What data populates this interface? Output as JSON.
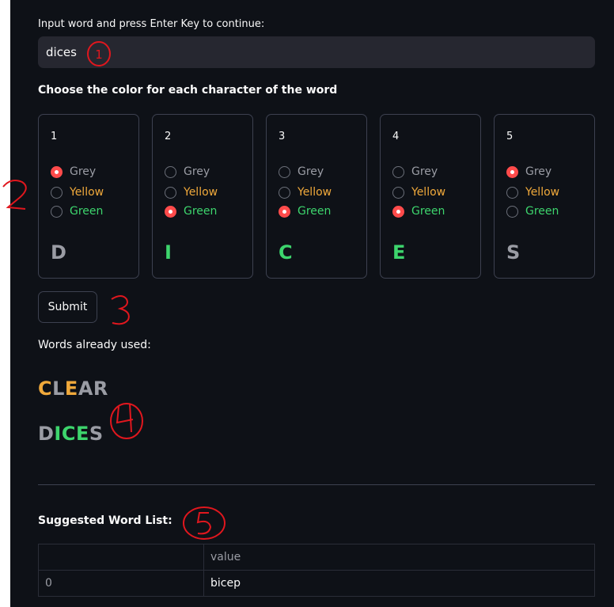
{
  "input": {
    "label": "Input word and press Enter Key to continue:",
    "value": "dices"
  },
  "color_section": {
    "title": "Choose the color for each character of the word",
    "option_labels": [
      "Grey",
      "Yellow",
      "Green"
    ],
    "cards": [
      {
        "number": "1",
        "selected": "Grey",
        "letter": "D"
      },
      {
        "number": "2",
        "selected": "Green",
        "letter": "I"
      },
      {
        "number": "3",
        "selected": "Green",
        "letter": "C"
      },
      {
        "number": "4",
        "selected": "Green",
        "letter": "E"
      },
      {
        "number": "5",
        "selected": "Grey",
        "letter": "S"
      }
    ]
  },
  "submit": {
    "label": "Submit"
  },
  "used_words": {
    "title": "Words already used:",
    "words": [
      [
        {
          "ch": "C",
          "color": "Yellow"
        },
        {
          "ch": "L",
          "color": "Grey"
        },
        {
          "ch": "E",
          "color": "Yellow"
        },
        {
          "ch": "A",
          "color": "Grey"
        },
        {
          "ch": "R",
          "color": "Grey"
        }
      ],
      [
        {
          "ch": "D",
          "color": "Grey"
        },
        {
          "ch": "I",
          "color": "Green"
        },
        {
          "ch": "C",
          "color": "Green"
        },
        {
          "ch": "E",
          "color": "Green"
        },
        {
          "ch": "S",
          "color": "Grey"
        }
      ]
    ]
  },
  "suggested": {
    "title": "Suggested Word List:",
    "columns": [
      "",
      "value"
    ],
    "rows": [
      [
        "0",
        "bicep"
      ]
    ]
  },
  "colors": {
    "background": "#0e1117",
    "input_bg": "#262730",
    "accent_red": "#ff4b4b",
    "grey": "#9a9ca4",
    "yellow": "#f0a93b",
    "green": "#3dd56d",
    "annotation_red": "#e0171e"
  },
  "annotations": [
    "1",
    "2",
    "3",
    "4",
    "5"
  ]
}
